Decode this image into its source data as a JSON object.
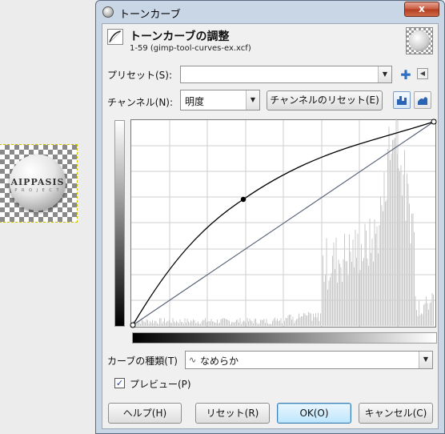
{
  "canvas_thumb": {
    "logo_text": "AIPPASIS",
    "logo_sub": "P R O J E C T"
  },
  "window": {
    "title": "トーンカーブ",
    "close_label": "x"
  },
  "header": {
    "title": "トーンカーブの調整",
    "subtitle": "1-59 (gimp-tool-curves-ex.xcf)"
  },
  "presets": {
    "label": "プリセット(S):",
    "value": "",
    "add_icon": "plus-icon",
    "menu_icon": "triangle-left-icon"
  },
  "channel": {
    "label": "チャンネル(N):",
    "value": "明度",
    "reset_label": "チャンネルのリセット(E)",
    "linear_icon": "linear-histogram-icon",
    "log_icon": "log-histogram-icon"
  },
  "curve_type": {
    "label": "カーブの種類(T)",
    "value": "なめらか",
    "icon": "smooth-curve-icon"
  },
  "preview": {
    "label": "プレビュー(P)",
    "checked": true
  },
  "buttons": {
    "help": "ヘルプ(H)",
    "reset": "リセット(R)",
    "ok": "OK(O)",
    "cancel": "キャンセル(C)"
  },
  "curve": {
    "control_points": [
      [
        0,
        0
      ],
      [
        0.37,
        0.63
      ],
      [
        1,
        1
      ]
    ],
    "histogram_note": "luminance histogram concentrated in highlights"
  },
  "colors": {
    "titlebar": "#c9d6e6",
    "close": "#c75a3e",
    "curve": "#000000",
    "diagonal": "#5a6478",
    "histogram": "#c8c8c8"
  }
}
